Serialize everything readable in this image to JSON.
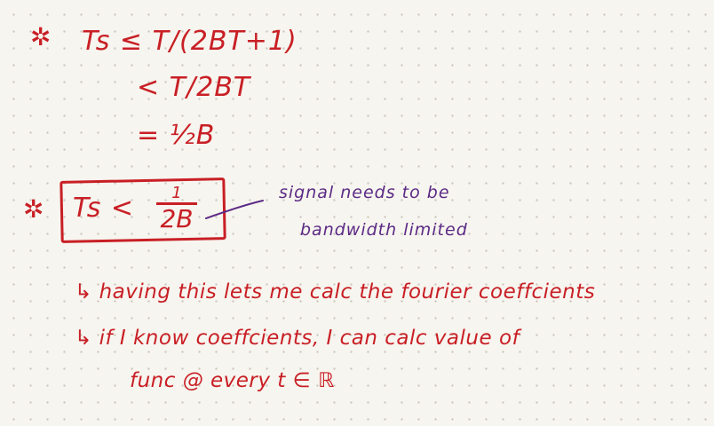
{
  "colors": {
    "red_ink": "#c81f25",
    "purple_ink": "#5b2a86",
    "paper": "#f7f5ef",
    "dot_grid": "#c9c6bd"
  },
  "icons": {
    "bullet": "star-icon"
  },
  "equations": {
    "star1": "✲",
    "line1": "Ts  ≤  T/(2BT+1)",
    "line2": "< T/2BT",
    "line3": "= ½B"
  },
  "boxed": {
    "star": "✲",
    "lhs": "Ts  <",
    "numerator": "1",
    "denominator": "2B"
  },
  "annotation": {
    "line1": "signal needs to be",
    "line2": "bandwidth limited"
  },
  "notes": {
    "line1": "↳ having this lets me calc the fourier coeffcients",
    "line2": "↳ if I know coeffcients, I can calc value of",
    "line3": "func  @  every  t ∈ ℝ"
  }
}
